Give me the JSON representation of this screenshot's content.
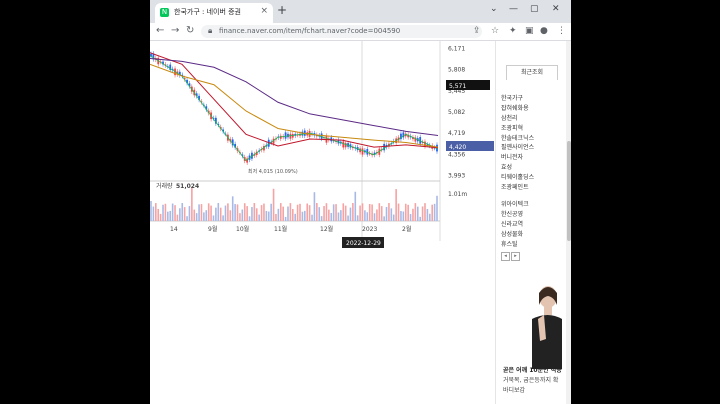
{
  "browser": {
    "tab_title": "한국가구 : 네이버 증권",
    "tab_close": "×",
    "new_tab": "+",
    "url": "finance.naver.com/item/fchart.naver?code=004590",
    "window_controls": [
      "⌄",
      "—",
      "▢",
      "✕"
    ]
  },
  "chart": {
    "y_labels": [
      "6,171",
      "5,808",
      "5,445",
      "5,082",
      "4,719",
      "4,356",
      "3,993"
    ],
    "current_price_tag": "5,571",
    "last_price_tag": "4,420",
    "low_annotation": "최저 4,015 (10.09%)",
    "volume_label": "거래량",
    "volume_value": "51,024",
    "volume_axis": "1.01m",
    "x_labels": [
      "14",
      "9월",
      "10월",
      "11월",
      "12월",
      "2023",
      "2월"
    ],
    "crosshair_date": "2022-12-29",
    "colors": {
      "up": "#ef4444",
      "down": "#2563eb",
      "ma1": "#1db954",
      "ma2": "#c0152a",
      "ma3": "#c8890f",
      "ma4": "#5b2a86",
      "price_tag_bg": "#111",
      "last_tag_bg": "#4a5fa5"
    }
  },
  "chart_data": {
    "type": "line",
    "title": "",
    "xlabel": "",
    "ylabel": "",
    "ylim": [
      3900,
      6300
    ],
    "x": [
      "14",
      "9월",
      "10월",
      "11월",
      "12월",
      "2023",
      "2월"
    ],
    "series": [
      {
        "values": [
          6050,
          5700,
          4950,
          4250,
          4650,
          4720,
          4550,
          4350,
          4700,
          4450
        ]
      },
      {
        "values": [
          6100,
          5900,
          5300,
          4700,
          4500,
          4620,
          4600,
          4480,
          4520,
          4470
        ]
      },
      {
        "values": [
          5900,
          5700,
          5550,
          5100,
          4800,
          4700,
          4650,
          4600,
          4560,
          4480
        ]
      },
      {
        "values": [
          6000,
          5950,
          5850,
          5600,
          5250,
          5050,
          4950,
          4850,
          4750,
          4680
        ]
      }
    ]
  },
  "sidebar": {
    "recent_label": "최근조회",
    "group1": [
      "한국가구",
      "잡혀쉐화용",
      "삼천리",
      "조광피혁",
      "한솔테크닉스"
    ],
    "group2": [
      "필옌사이언스",
      "버니전자",
      "효성",
      "티웨이홀딩스",
      "조광페인트"
    ],
    "group3": [
      "위아이텍크",
      "한신공영",
      "신라교역",
      "삼성물화",
      "휴스틸"
    ],
    "pager": [
      "◂",
      "▸"
    ],
    "ad_text": [
      "곧은 어깨 10분만 적용",
      "거북목, 굽은등까지 확",
      "바디보감"
    ]
  }
}
